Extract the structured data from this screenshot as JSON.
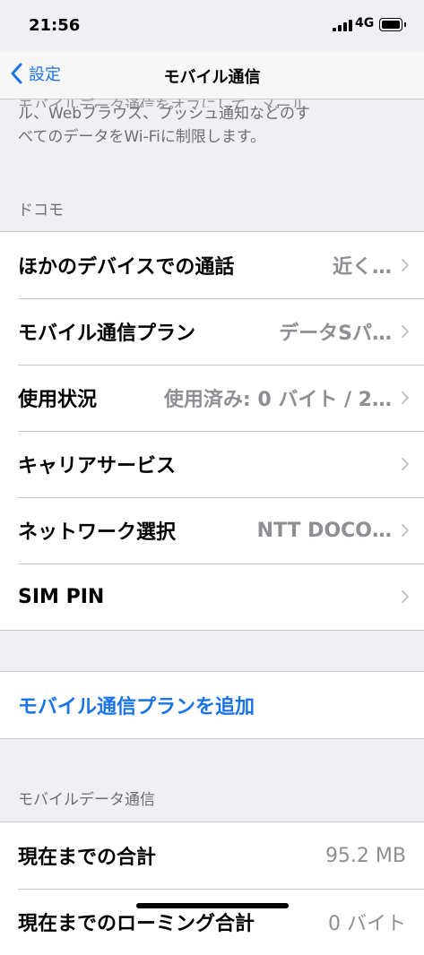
{
  "status": {
    "time": "21:56",
    "network": "4G"
  },
  "nav": {
    "back_label": "設定",
    "title": "モバイル通信"
  },
  "footer": {
    "cut_line": "モバイルデータ通信をオフにして、メール",
    "line1": "ル、Webブラウズ、プッシュ通知などのす",
    "line2": "べてのデータをWi-Fiに制限します。"
  },
  "carrier": {
    "header": "ドコモ",
    "rows": [
      {
        "label": "ほかのデバイスでの通話",
        "value": "近く…"
      },
      {
        "label": "モバイル通信プラン",
        "value": "データSパ…"
      },
      {
        "label": "使用状況",
        "value": "使用済み: 0 バイト / 2…"
      },
      {
        "label": "キャリアサービス",
        "value": ""
      },
      {
        "label": "ネットワーク選択",
        "value": "NTT DOCO…"
      },
      {
        "label": "SIM PIN",
        "value": ""
      }
    ]
  },
  "add_plan": {
    "label": "モバイル通信プランを追加"
  },
  "mobile_data": {
    "header": "モバイルデータ通信",
    "rows": [
      {
        "label": "現在までの合計",
        "value": "95.2 MB"
      },
      {
        "label": "現在までのローミング合計",
        "value": "0 バイト"
      }
    ]
  },
  "colors": {
    "accent": "#1a73e8",
    "background": "#efeff4",
    "secondary_text": "#8e8e93"
  }
}
